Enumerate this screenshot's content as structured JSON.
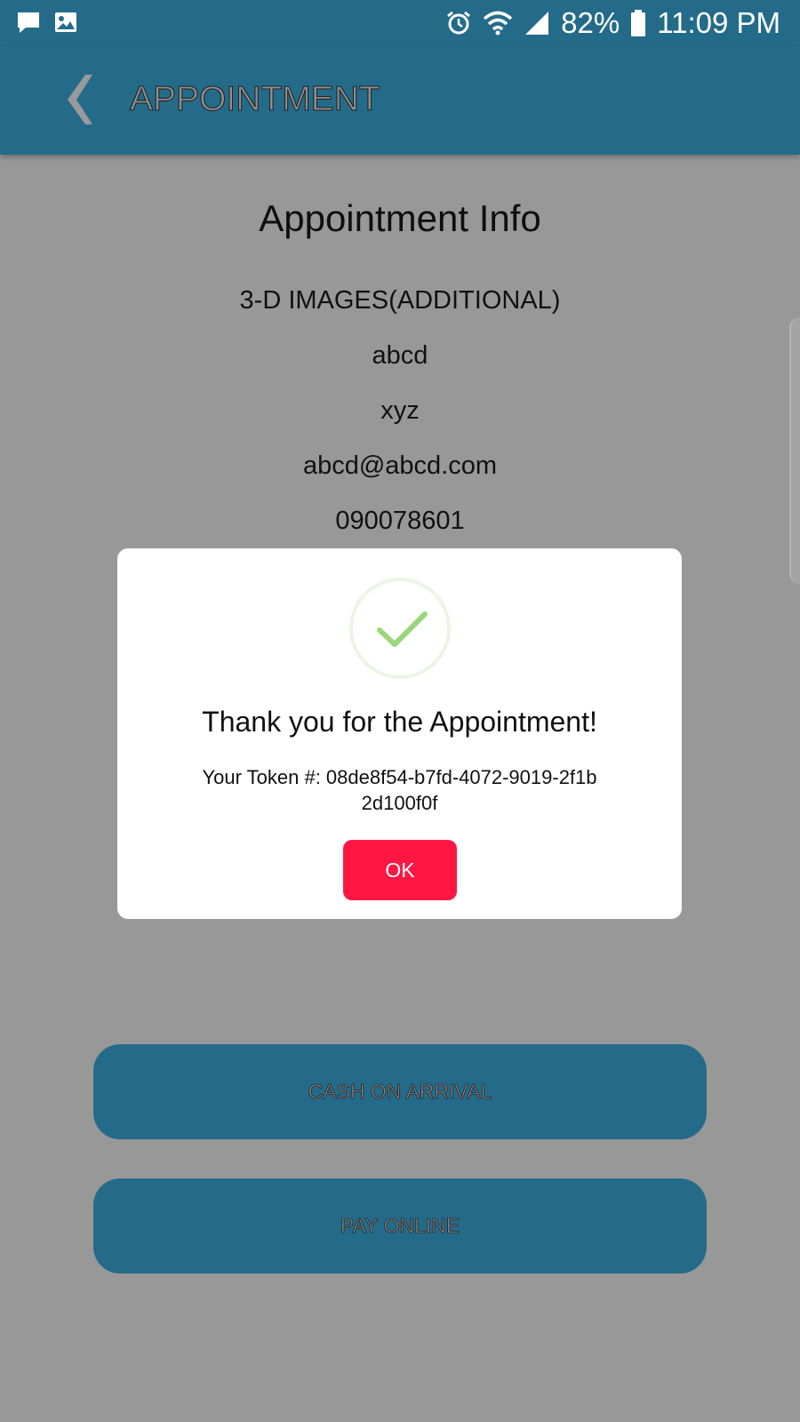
{
  "status_bar": {
    "battery": "82%",
    "time": "11:09 PM",
    "icons": [
      "message-icon",
      "image-icon",
      "alarm-icon",
      "wifi-icon",
      "signal-icon",
      "battery-icon"
    ]
  },
  "app_bar": {
    "title": "APPOINTMENT",
    "back_icon": "back-chevron-icon"
  },
  "info": {
    "title": "Appointment Info",
    "service": "3-D IMAGES(ADDITIONAL)",
    "first_name": "abcd",
    "last_name": "xyz",
    "email": "abcd@abcd.com",
    "phone": "090078601"
  },
  "dialog": {
    "icon": "success-check-icon",
    "title": "Thank you for the Appointment!",
    "token": "Your Token #: 08de8f54-b7fd-4072-9019-2f1b2d100f0f",
    "ok_label": "OK"
  },
  "actions": {
    "cash_label": "CASH ON ARRIVAL",
    "online_label": "PAY ONLINE"
  },
  "colors": {
    "primary": "#246b8a",
    "overlay_bg": "#989898",
    "ok_button": "#ff1744",
    "check": "#98d87a"
  }
}
